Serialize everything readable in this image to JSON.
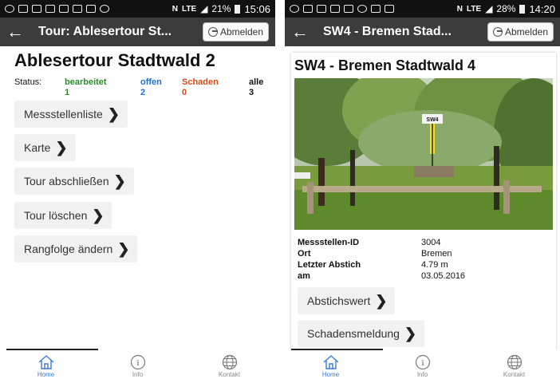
{
  "left": {
    "statusbar": {
      "battery": "21%",
      "time": "15:06",
      "network": "LTE"
    },
    "appbar": {
      "title": "Tour: Ablesertour St...",
      "logout_label": "Abmelden"
    },
    "page_title": "Ablesertour Stadtwald 2",
    "status": {
      "label": "Status:",
      "columns": [
        {
          "name": "bearbeitet",
          "count": "1"
        },
        {
          "name": "offen",
          "count": "2"
        },
        {
          "name": "Schaden",
          "count": "0"
        },
        {
          "name": "alle",
          "count": "3"
        }
      ]
    },
    "actions": [
      "Messstellenliste",
      "Karte",
      "Tour abschließen",
      "Tour löschen",
      "Rangfolge ändern"
    ],
    "nav": [
      {
        "label": "Home",
        "icon": "home-icon"
      },
      {
        "label": "Info",
        "icon": "info-icon"
      },
      {
        "label": "Kontakt",
        "icon": "globe-icon"
      }
    ]
  },
  "right": {
    "statusbar": {
      "battery": "28%",
      "time": "14:20",
      "network": "LTE"
    },
    "appbar": {
      "title": "SW4 - Bremen Stad...",
      "logout_label": "Abmelden"
    },
    "detail_title": "SW4 - Bremen Stadtwald 4",
    "photo_sign_label": "SW4",
    "fields": [
      {
        "key": "Messstellen-ID",
        "value": "3004"
      },
      {
        "key": "Ort",
        "value": "Bremen"
      },
      {
        "key": "Letzter Abstich",
        "value": "4.79 m"
      },
      {
        "key": "am",
        "value": "03.05.2016"
      }
    ],
    "actions": [
      "Abstichswert",
      "Schadensmeldung"
    ],
    "nav": [
      {
        "label": "Home",
        "icon": "home-icon"
      },
      {
        "label": "Info",
        "icon": "info-icon"
      },
      {
        "label": "Kontakt",
        "icon": "globe-icon"
      }
    ]
  },
  "colors": {
    "appbar": "#3c3c3c",
    "bearbeitet": "#2a8a2a",
    "offen": "#1c6fd1",
    "schaden": "#d64a1a",
    "nav_active": "#3a78d8"
  }
}
